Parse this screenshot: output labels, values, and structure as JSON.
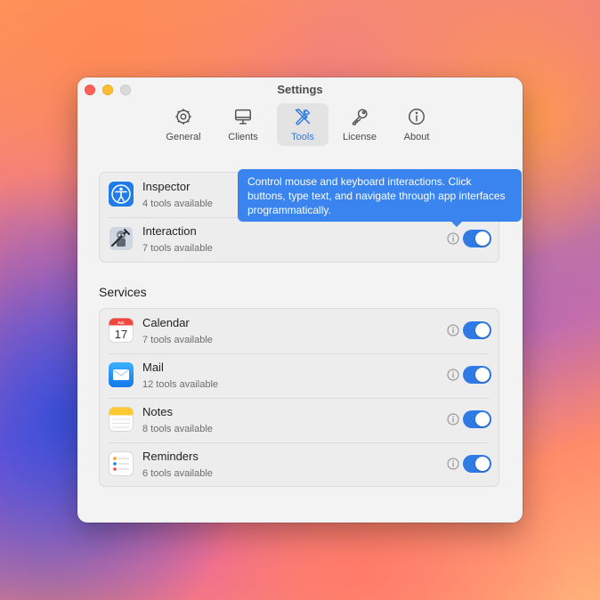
{
  "window": {
    "title": "Settings"
  },
  "toolbar": {
    "items": [
      {
        "label": "General",
        "icon": "gear-icon"
      },
      {
        "label": "Clients",
        "icon": "monitor-icon"
      },
      {
        "label": "Tools",
        "icon": "tools-icon",
        "selected": true
      },
      {
        "label": "License",
        "icon": "key-icon"
      },
      {
        "label": "About",
        "icon": "info-circle-icon"
      }
    ]
  },
  "tooltip": {
    "text": "Control mouse and keyboard interactions. Click buttons, type text, and navigate through app interfaces programmatically."
  },
  "system_group": [
    {
      "title": "Inspector",
      "subtitle": "4 tools available",
      "icon": "accessibility-inspector-icon",
      "enabled": true
    },
    {
      "title": "Interaction",
      "subtitle": "7 tools available",
      "icon": "automator-robot-icon",
      "enabled": true
    }
  ],
  "services": {
    "title": "Services",
    "items": [
      {
        "title": "Calendar",
        "subtitle": "7 tools available",
        "icon": "calendar-icon",
        "enabled": true,
        "icon_month": "JUL",
        "icon_day": "17"
      },
      {
        "title": "Mail",
        "subtitle": "12 tools available",
        "icon": "mail-icon",
        "enabled": true
      },
      {
        "title": "Notes",
        "subtitle": "8 tools available",
        "icon": "notes-icon",
        "enabled": true
      },
      {
        "title": "Reminders",
        "subtitle": "6 tools available",
        "icon": "reminders-icon",
        "enabled": true
      }
    ]
  },
  "colors": {
    "accent": "#2f7ae5",
    "tooltip": "#3a84f0"
  }
}
